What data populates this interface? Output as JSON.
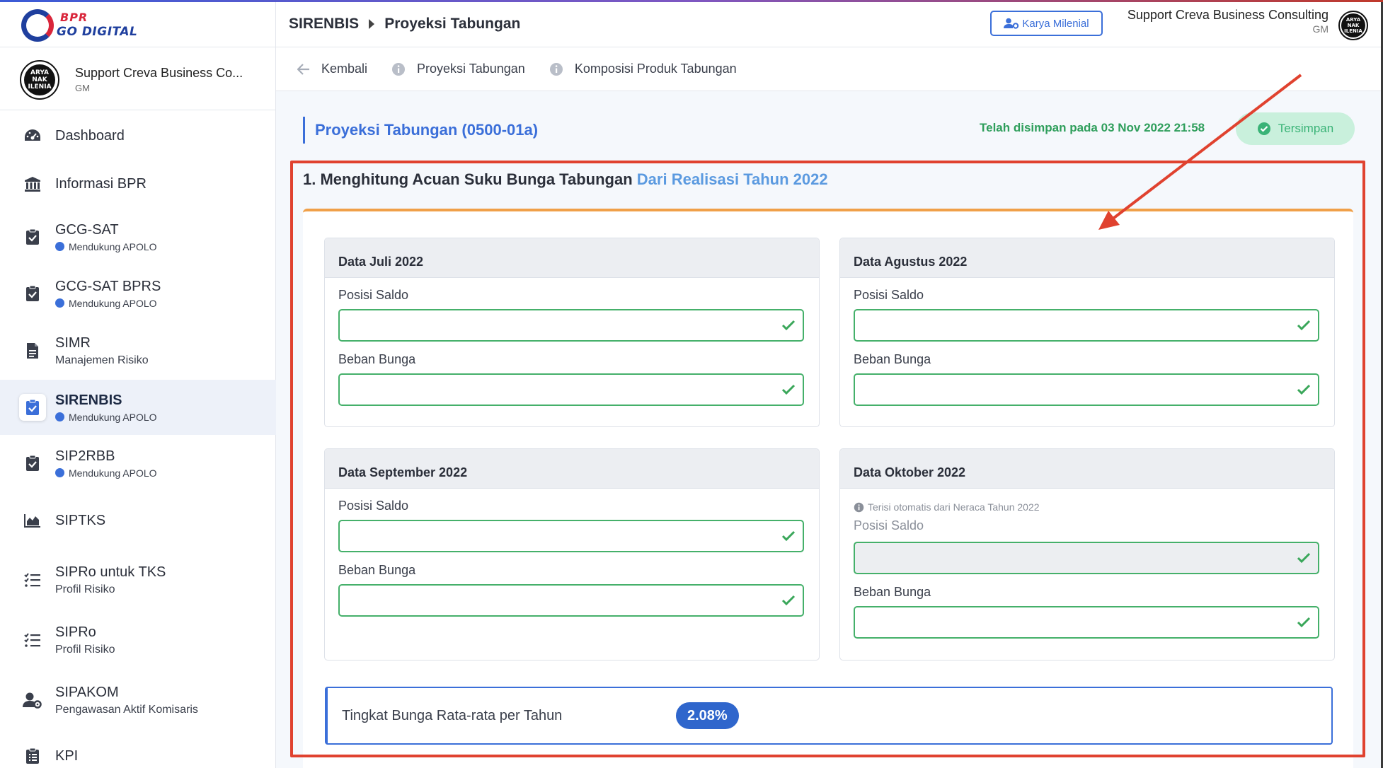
{
  "brand": {
    "logo_line1": "BPR",
    "logo_line2": "GO DIGITAL",
    "avatar_text": "ARYA NAK ILENIA"
  },
  "sidebar": {
    "user_name": "Support Creva Business Co...",
    "user_role": "GM",
    "items": [
      {
        "label": "Dashboard",
        "sub": "",
        "icon": "dashboard-icon"
      },
      {
        "label": "Informasi BPR",
        "sub": "",
        "icon": "bank-icon"
      },
      {
        "label": "GCG-SAT",
        "sub": "Mendukung APOLO",
        "icon": "clipboard-check-icon"
      },
      {
        "label": "GCG-SAT BPRS",
        "sub": "Mendukung APOLO",
        "icon": "clipboard-check-icon"
      },
      {
        "label": "SIMR",
        "sub": "Manajemen Risiko",
        "icon": "document-icon"
      },
      {
        "label": "SIRENBIS",
        "sub": "Mendukung APOLO",
        "icon": "clipboard-check-icon"
      },
      {
        "label": "SIP2RBB",
        "sub": "Mendukung APOLO",
        "icon": "clipboard-check-icon"
      },
      {
        "label": "SIPTKS",
        "sub": "",
        "icon": "area-chart-icon"
      },
      {
        "label": "SIPRo untuk TKS",
        "sub": "Profil Risiko",
        "icon": "checklist-icon"
      },
      {
        "label": "SIPRo",
        "sub": "Profil Risiko",
        "icon": "checklist-icon"
      },
      {
        "label": "SIPAKOM",
        "sub": "Pengawasan Aktif Komisaris",
        "icon": "user-cog-icon"
      },
      {
        "label": "KPI",
        "sub": "",
        "icon": "clipboard-list-icon"
      }
    ]
  },
  "header": {
    "crumb_root": "SIRENBIS",
    "crumb_page": "Proyeksi Tabungan",
    "org_button": "Karya Milenial",
    "user_name": "Support Creva Business Consulting",
    "user_role": "GM"
  },
  "subnav": {
    "back": "Kembali",
    "tab1": "Proyeksi Tabungan",
    "tab2": "Komposisi Produk Tabungan"
  },
  "content": {
    "page_title": "Proyeksi Tabungan (0500-01a)",
    "saved_text": "Telah disimpan pada 03 Nov 2022 21:58",
    "saved_button": "Tersimpan",
    "section_title": "1. Menghitung Acuan Suku Bunga Tabungan",
    "section_accent": "Dari Realisasi Tahun 2022",
    "panels": [
      {
        "title": "Data Juli 2022",
        "saldo_label": "Posisi Saldo",
        "saldo_value": "",
        "beban_label": "Beban Bunga",
        "beban_value": ""
      },
      {
        "title": "Data Agustus 2022",
        "saldo_label": "Posisi Saldo",
        "saldo_value": "",
        "beban_label": "Beban Bunga",
        "beban_value": ""
      },
      {
        "title": "Data September 2022",
        "saldo_label": "Posisi Saldo",
        "saldo_value": "",
        "beban_label": "Beban Bunga",
        "beban_value": ""
      },
      {
        "title": "Data Oktober 2022",
        "note": "Terisi otomatis dari Neraca Tahun 2022",
        "saldo_label": "Posisi Saldo",
        "saldo_value": "",
        "beban_label": "Beban Bunga",
        "beban_value": ""
      }
    ],
    "rate_label": "Tingkat Bunga Rata-rata per Tahun",
    "rate_value": "2.08%"
  },
  "colors": {
    "primary": "#3b6fd9",
    "success": "#45b06a",
    "accent_orange": "#f0a049",
    "annotation_red": "#e0422f"
  }
}
